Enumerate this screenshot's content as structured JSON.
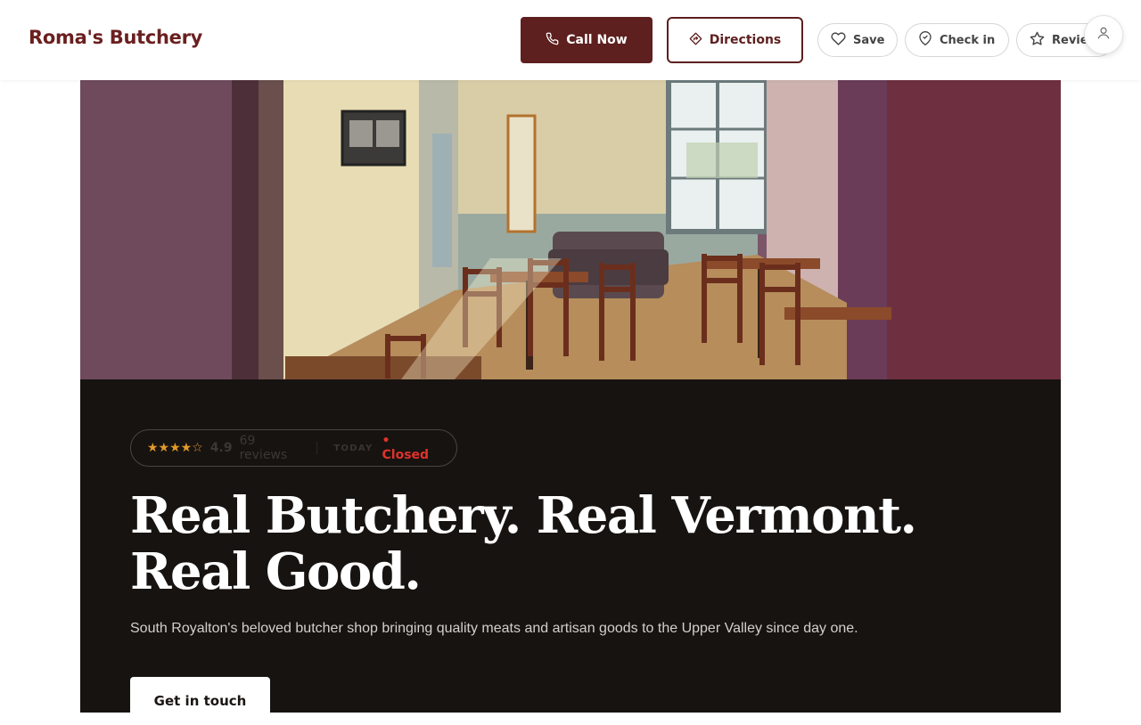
{
  "header": {
    "brand": "Roma's Butchery",
    "call_label": "Call Now",
    "directions_label": "Directions",
    "save_label": "Save",
    "checkin_label": "Check in",
    "review_label": "Review"
  },
  "hero": {
    "image_icon": "cafe-interior-photo",
    "stars": "★★★★☆",
    "rating": "4.9",
    "reviews": "69 reviews",
    "today_label": "TODAY",
    "status": "• Closed",
    "headline": "Real Butchery. Real Vermont. Real Good.",
    "subtext": "South Royalton's beloved butcher shop bringing quality meats and artisan goods to the Upper Valley since day one.",
    "cta_label": "Get in touch"
  },
  "colors": {
    "brand": "#6b1f1f",
    "button_primary": "#5e1f1f",
    "panel_bg": "#171311",
    "star": "#e39a2a",
    "closed": "#e0322a"
  }
}
